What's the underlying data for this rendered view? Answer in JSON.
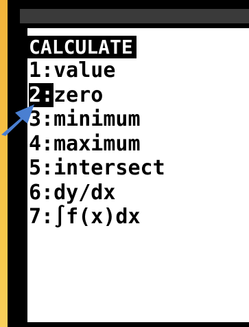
{
  "menu": {
    "title": "CALCULATE",
    "items": [
      {
        "key": "1:",
        "label": "value"
      },
      {
        "key": "2:",
        "label": "zero"
      },
      {
        "key": "3:",
        "label": "minimum"
      },
      {
        "key": "4:",
        "label": "maximum"
      },
      {
        "key": "5:",
        "label": "intersect"
      },
      {
        "key": "6:",
        "label": "dy/dx"
      },
      {
        "key": "7:",
        "label": "∫f(x)dx"
      }
    ],
    "selected_index": 1
  },
  "colors": {
    "background": "#f8ca4c",
    "bezel": "#000000",
    "screen": "#ffffff",
    "highlight": "#000000",
    "pointer": "#4a7fd1"
  },
  "icons": {
    "pointer": "arrow-pointer-icon"
  }
}
